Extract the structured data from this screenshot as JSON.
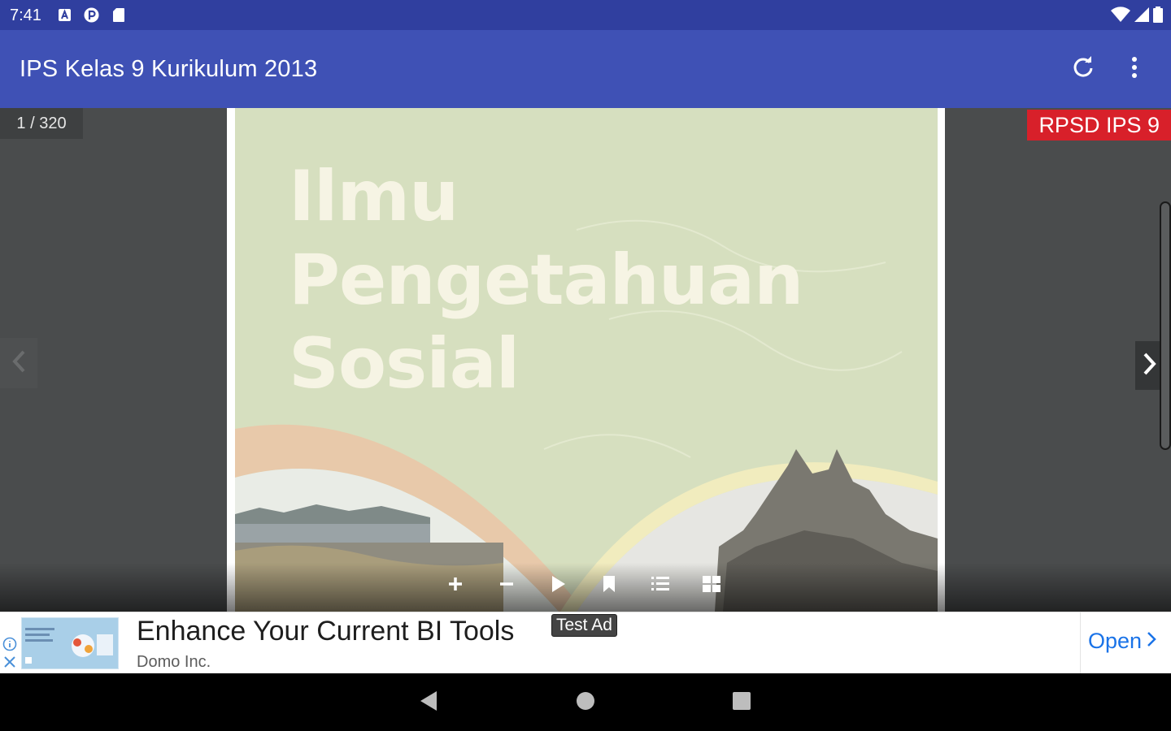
{
  "status_bar": {
    "time": "7:41",
    "notification_icons": [
      "a-square-icon",
      "p-circle-icon",
      "sd-card-icon"
    ],
    "system_icons": [
      "wifi-icon",
      "cell-signal-icon",
      "battery-icon"
    ]
  },
  "app_bar": {
    "title": "IPS Kelas 9 Kurikulum 2013",
    "actions": [
      "refresh-icon",
      "more-vert-icon"
    ]
  },
  "viewer": {
    "page_counter": "1 / 320",
    "badge": "RPSD IPS 9",
    "book_cover": {
      "title_lines": [
        "Ilmu",
        "Pengetahuan",
        "Sosial"
      ]
    },
    "toolbar": [
      "zoom-in-icon",
      "zoom-out-icon",
      "play-icon",
      "bookmark-icon",
      "list-icon",
      "grid-icon"
    ]
  },
  "ad": {
    "headline": "Enhance Your Current BI Tools",
    "advertiser": "Domo Inc.",
    "test_label": "Test Ad",
    "cta": "Open"
  },
  "navigation_bar": [
    "back-icon",
    "home-icon",
    "recents-icon"
  ],
  "colors": {
    "status_bar": "#303f9f",
    "app_bar": "#3f51b5",
    "viewer_bg": "#4a4c4d",
    "badge": "#d8202a",
    "cover_bg": "#d6dfbf",
    "ad_cta": "#1a73e8"
  }
}
